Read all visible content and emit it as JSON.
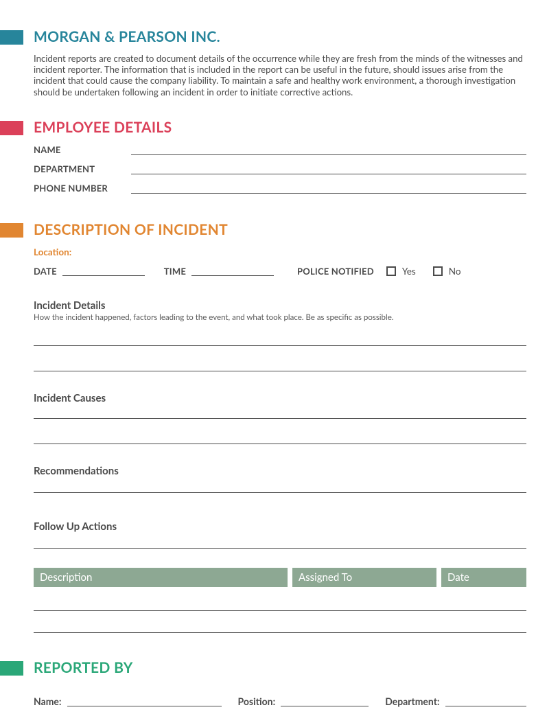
{
  "header": {
    "company": "MORGAN & PEARSON INC.",
    "intro": "Incident reports are created to document details of the occurrence while they are fresh from the minds of the witnesses and incident reporter. The information that is included in the report can be useful in the future, should issues arise from the incident that could cause the company liability. To maintain a safe and healthy work environment, a thorough investigation should be undertaken following an incident in order to initiate corrective actions."
  },
  "employee": {
    "title": "EMPLOYEE DETAILS",
    "name_label": "NAME",
    "dept_label": "DEPARTMENT",
    "phone_label": "PHONE NUMBER"
  },
  "incident": {
    "title": "DESCRIPTION OF INCIDENT",
    "location_label": "Location:",
    "date_label": "DATE",
    "time_label": "TIME",
    "police_label": "POLICE NOTIFIED",
    "yes": "Yes",
    "no": "No",
    "details_heading": "Incident Details",
    "details_helper": "How the incident happened, factors leading to the event, and what took place. Be as specific as possible.",
    "causes_heading": "Incident Causes",
    "recs_heading": "Recommendations",
    "followup_heading": "Follow Up Actions",
    "table": {
      "description": "Description",
      "assigned": "Assigned To",
      "date": "Date"
    }
  },
  "reported": {
    "title": "REPORTED BY",
    "name_label": "Name:",
    "position_label": "Position:",
    "dept_label": "Department:"
  }
}
